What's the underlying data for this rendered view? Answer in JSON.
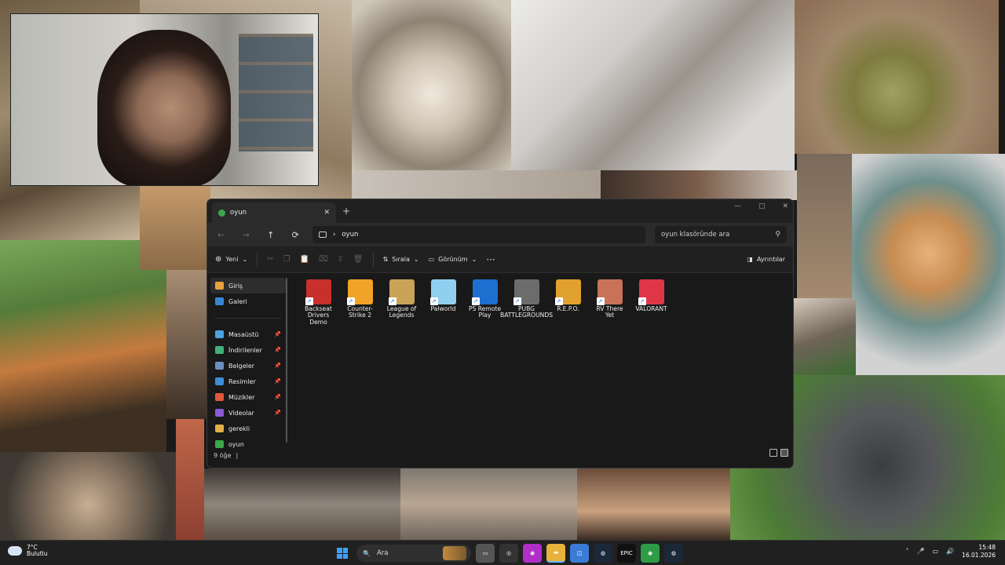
{
  "window": {
    "tab_title": "oyun",
    "tab_close": "✕",
    "new_tab": "+",
    "controls": [
      "—",
      "▢",
      "✕"
    ]
  },
  "nav": {
    "back": "←",
    "forward": "→",
    "up": "↑",
    "refresh": "⟳",
    "breadcrumb_sep": "›",
    "path": "oyun",
    "search_placeholder": "oyun klasöründe ara"
  },
  "toolbar": {
    "new_label": "Yeni",
    "sort_label": "Sırala",
    "view_label": "Görünüm",
    "more_label": "···",
    "details_label": "Ayrıntılar",
    "dropdown_caret": "⌄"
  },
  "sidebar": {
    "items": [
      {
        "label": "Giriş",
        "icon": "home-icon",
        "color": "#e8a33d"
      },
      {
        "label": "Galeri",
        "icon": "gallery-icon",
        "color": "#3a86d6"
      },
      {
        "label": "Masaüstü",
        "icon": "desktop-icon",
        "color": "#4aa3df",
        "pinned": true
      },
      {
        "label": "İndirilenler",
        "icon": "download-icon",
        "color": "#3fb07a",
        "pinned": true
      },
      {
        "label": "Belgeler",
        "icon": "documents-icon",
        "color": "#6c8ebf",
        "pinned": true
      },
      {
        "label": "Resimler",
        "icon": "pictures-icon",
        "color": "#3d8fd6",
        "pinned": true
      },
      {
        "label": "Müzikler",
        "icon": "music-icon",
        "color": "#e0583e",
        "pinned": true
      },
      {
        "label": "Videolar",
        "icon": "videos-icon",
        "color": "#8c5ad6",
        "pinned": true
      },
      {
        "label": "gerekli",
        "icon": "folder-icon",
        "color": "#e2b04a"
      },
      {
        "label": "oyun",
        "icon": "folder-icon",
        "color": "#3aa84a"
      }
    ],
    "pin_glyph": "📌"
  },
  "files": [
    {
      "name": "Backseat Drivers Demo",
      "icon": "car-icon",
      "color": "#c7302c"
    },
    {
      "name": "Counter-Strike 2",
      "icon": "cs2-icon",
      "color": "#f0a326"
    },
    {
      "name": "League of Legends",
      "icon": "lol-icon",
      "color": "#c9a456"
    },
    {
      "name": "Palworld",
      "icon": "palworld-icon",
      "color": "#8fd0f0"
    },
    {
      "name": "PS Remote Play",
      "icon": "ps-remote-icon",
      "color": "#1d6fd0"
    },
    {
      "name": "PUBG BATTLEGROUNDS",
      "icon": "pubg-icon",
      "color": "#6c6c6c"
    },
    {
      "name": "R.E.P.O.",
      "icon": "repo-icon",
      "color": "#e0a12e"
    },
    {
      "name": "RV There Yet",
      "icon": "rv-icon",
      "color": "#c8725a"
    },
    {
      "name": "VALORANT",
      "icon": "valorant-icon",
      "color": "#e0364a"
    }
  ],
  "shortcut_glyph": "↗",
  "status": {
    "count": "9 öğe",
    "sep": "|"
  },
  "taskbar": {
    "weather_temp": "7°C",
    "weather_desc": "Bulutlu",
    "search_label": "Ara",
    "search_icon": "🔍",
    "time": "15:48",
    "date": "16.01.2026",
    "apps": [
      {
        "name": "task-view",
        "glyph": "▭",
        "color": "#555"
      },
      {
        "name": "chatgpt",
        "glyph": "◎",
        "color": "#333"
      },
      {
        "name": "app-purple",
        "glyph": "◉",
        "color": "#b02fc9"
      },
      {
        "name": "file-explorer",
        "glyph": "▬",
        "color": "#e8b33a",
        "active": true
      },
      {
        "name": "store",
        "glyph": "◫",
        "color": "#3a7bd5"
      },
      {
        "name": "steam",
        "glyph": "◍",
        "color": "#1b2838"
      },
      {
        "name": "epic-games",
        "glyph": "EPIC",
        "color": "#111"
      },
      {
        "name": "chrome",
        "glyph": "◉",
        "color": "#2e9b46"
      },
      {
        "name": "steam-2",
        "glyph": "◍",
        "color": "#1b2838"
      }
    ],
    "tray": [
      "˄",
      "🎤",
      "▭",
      "🔊"
    ]
  }
}
